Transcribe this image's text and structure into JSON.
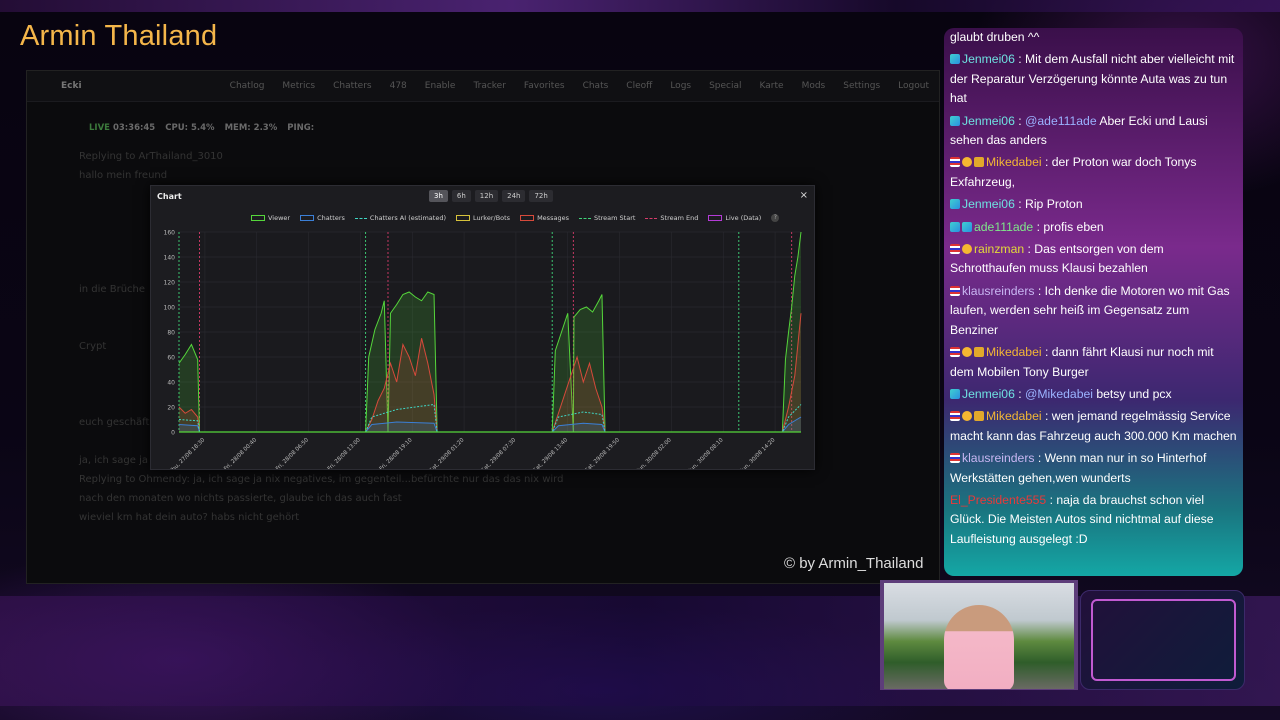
{
  "brand_title": "Armin Thailand",
  "watermark": "© by Armin_Thailand",
  "dashboard": {
    "app_name": "Ecki",
    "nav": [
      "Chatlog",
      "Metrics",
      "Chatters",
      "478",
      "Enable",
      "Tracker",
      "Favorites",
      "Chats",
      "Cleoff",
      "Logs",
      "Special",
      "Karte",
      "Mods",
      "Settings",
      "Logout"
    ],
    "status": {
      "live": "LIVE",
      "uptime": "03:36:45",
      "cpu_label": "CPU:",
      "cpu": "5.4%",
      "mem_label": "MEM:",
      "mem": "2.3%",
      "ping_label": "PING:"
    },
    "faint_chat": [
      "Replying to ArThailand_3010",
      "hallo mein freund",
      "",
      "",
      "",
      "",
      "",
      "in die Brüche",
      "",
      "",
      "Crypt",
      "",
      "",
      "",
      "euch geschäft",
      "",
      "ja, ich sage ja nix negatives, im gegenteil...befürchte nur das das nix wird",
      "Replying to Ohmendy: ja, ich sage ja nix negatives, im gegenteil...befürchte nur das das nix wird",
      "nach den monaten wo nichts passierte, glaube ich das auch fast",
      "wieviel km hat dein auto? habs nicht gehört"
    ]
  },
  "chart_panel": {
    "title": "Chart",
    "ranges": [
      "3h",
      "6h",
      "12h",
      "24h",
      "72h"
    ],
    "active_range": "3h",
    "close_label": "×",
    "help_label": "?"
  },
  "chart_data": {
    "type": "line",
    "ylim": [
      0,
      160
    ],
    "yticks": [
      0,
      20,
      40,
      60,
      80,
      100,
      120,
      140,
      160
    ],
    "xticks": [
      "Thu, 27/08 18:30",
      "Fri, 28/08 00:40",
      "Fri, 28/08 06:50",
      "Fri, 28/08 13:00",
      "Fri, 28/08 19:10",
      "Sat, 29/08 01:20",
      "Sat, 29/08 07:30",
      "Sat, 29/08 13:40",
      "Sat, 29/08 19:50",
      "Sun, 30/08 02:00",
      "Sun, 30/08 08:10",
      "Sun, 30/08 14:20"
    ],
    "xrange": [
      0,
      100
    ],
    "legend": [
      {
        "name": "Viewer",
        "color": "#55d63b",
        "style": "box"
      },
      {
        "name": "Chatters",
        "color": "#3b7fd6",
        "style": "box"
      },
      {
        "name": "Chatters AI (estimated)",
        "color": "#3fd6c4",
        "style": "dash"
      },
      {
        "name": "Lurker/Bots",
        "color": "#d6c23b",
        "style": "box"
      },
      {
        "name": "Messages",
        "color": "#d64a3b",
        "style": "box"
      },
      {
        "name": "Stream Start",
        "color": "#3fd67a",
        "style": "dash"
      },
      {
        "name": "Stream End",
        "color": "#d63b6a",
        "style": "dash"
      },
      {
        "name": "Live (Data)",
        "color": "#b43bd6",
        "style": "box"
      }
    ],
    "stream_starts": [
      0,
      30,
      60,
      90
    ],
    "stream_ends": [
      3.3,
      33.6,
      63.4,
      98.5
    ],
    "series": [
      {
        "name": "Viewer",
        "color": "#55d63b",
        "points": [
          [
            0,
            55
          ],
          [
            1,
            62
          ],
          [
            2,
            70
          ],
          [
            3,
            58
          ],
          [
            3.3,
            0
          ],
          [
            30,
            0
          ],
          [
            30.5,
            60
          ],
          [
            31.5,
            82
          ],
          [
            32.5,
            95
          ],
          [
            33,
            105
          ],
          [
            33.6,
            0
          ],
          [
            34,
            95
          ],
          [
            35,
            102
          ],
          [
            36,
            110
          ],
          [
            37,
            112
          ],
          [
            38,
            108
          ],
          [
            39,
            105
          ],
          [
            40,
            112
          ],
          [
            41,
            110
          ],
          [
            41.5,
            0
          ],
          [
            60,
            0
          ],
          [
            60.5,
            65
          ],
          [
            61.5,
            80
          ],
          [
            62.5,
            95
          ],
          [
            63.4,
            0
          ],
          [
            63.5,
            92
          ],
          [
            64.5,
            98
          ],
          [
            65.5,
            100
          ],
          [
            66.5,
            96
          ],
          [
            67.5,
            105
          ],
          [
            68,
            110
          ],
          [
            68.5,
            0
          ],
          [
            97,
            0
          ],
          [
            97.5,
            58
          ],
          [
            98,
            80
          ],
          [
            98.5,
            100
          ],
          [
            99,
            125
          ],
          [
            99.5,
            140
          ],
          [
            100,
            160
          ]
        ]
      },
      {
        "name": "Messages",
        "color": "#d64a3b",
        "points": [
          [
            0,
            20
          ],
          [
            1,
            15
          ],
          [
            2,
            18
          ],
          [
            3,
            12
          ],
          [
            3.3,
            0
          ],
          [
            30,
            0
          ],
          [
            31,
            10
          ],
          [
            32,
            25
          ],
          [
            33,
            35
          ],
          [
            34,
            55
          ],
          [
            35,
            40
          ],
          [
            36,
            70
          ],
          [
            37,
            60
          ],
          [
            38,
            45
          ],
          [
            39,
            75
          ],
          [
            40,
            55
          ],
          [
            41,
            30
          ],
          [
            41.5,
            0
          ],
          [
            60,
            0
          ],
          [
            61,
            15
          ],
          [
            62,
            30
          ],
          [
            63,
            45
          ],
          [
            64,
            60
          ],
          [
            65,
            40
          ],
          [
            66,
            55
          ],
          [
            67,
            35
          ],
          [
            68,
            20
          ],
          [
            68.5,
            0
          ],
          [
            97,
            0
          ],
          [
            98,
            20
          ],
          [
            99,
            45
          ],
          [
            100,
            95
          ]
        ]
      },
      {
        "name": "Chatters",
        "color": "#3b7fd6",
        "points": [
          [
            0,
            6
          ],
          [
            3,
            5
          ],
          [
            3.3,
            0
          ],
          [
            30,
            0
          ],
          [
            31,
            6
          ],
          [
            35,
            8
          ],
          [
            41,
            7
          ],
          [
            41.5,
            0
          ],
          [
            60,
            0
          ],
          [
            61,
            5
          ],
          [
            65,
            7
          ],
          [
            68,
            6
          ],
          [
            68.5,
            0
          ],
          [
            97,
            0
          ],
          [
            98,
            6
          ],
          [
            100,
            12
          ]
        ]
      },
      {
        "name": "Chatters AI (estimated)",
        "color": "#3fd6c4",
        "dashed": true,
        "points": [
          [
            0,
            10
          ],
          [
            3,
            9
          ],
          [
            3.3,
            0
          ],
          [
            30,
            0
          ],
          [
            31,
            12
          ],
          [
            35,
            18
          ],
          [
            41,
            22
          ],
          [
            41.5,
            0
          ],
          [
            60,
            0
          ],
          [
            61,
            12
          ],
          [
            65,
            16
          ],
          [
            68,
            14
          ],
          [
            68.5,
            0
          ],
          [
            97,
            0
          ],
          [
            98,
            12
          ],
          [
            100,
            22
          ]
        ]
      }
    ]
  },
  "chat": [
    {
      "badges": [],
      "user": "",
      "user_color": "#ffffff",
      "text": "glaubt druben ^^"
    },
    {
      "badges": [
        "sub"
      ],
      "user": "Jenmei06",
      "user_color": "#6fe0e0",
      "text": ": Mit dem Ausfall nicht aber vielleicht mit der Reparatur Verzögerung könnte Auta was zu tun hat"
    },
    {
      "badges": [
        "sub"
      ],
      "user": "Jenmei06",
      "user_color": "#6fe0e0",
      "text": ": @ade111ade Aber Ecki und Lausi sehen das anders",
      "mention": "@ade111ade"
    },
    {
      "badges": [
        "flag",
        "coin",
        "crown"
      ],
      "user": "Mikedabei",
      "user_color": "#f2b636",
      "text": ": der Proton war doch Tonys Exfahrzeug,"
    },
    {
      "badges": [
        "sub"
      ],
      "user": "Jenmei06",
      "user_color": "#6fe0e0",
      "text": ": Rip Proton"
    },
    {
      "badges": [
        "sub",
        "sub"
      ],
      "user": "ade111ade",
      "user_color": "#7fe88a",
      "text": ": profis eben"
    },
    {
      "badges": [
        "flag",
        "coin"
      ],
      "user": "rainzman",
      "user_color": "#e3d93a",
      "text": ": Das entsorgen von dem Schrotthaufen muss Klausi bezahlen"
    },
    {
      "badges": [
        "flag"
      ],
      "user": "klausreinders",
      "user_color": "#c8b6f2",
      "text": ": Ich denke die Motoren wo mit Gas laufen, werden sehr heiß im Gegensatz zum Benziner"
    },
    {
      "badges": [
        "flag",
        "coin",
        "crown"
      ],
      "user": "Mikedabei",
      "user_color": "#f2b636",
      "text": ": dann fährt Klausi nur noch mit dem Mobilen Tony Burger"
    },
    {
      "badges": [
        "sub"
      ],
      "user": "Jenmei06",
      "user_color": "#6fe0e0",
      "text": ": @Mikedabei betsy und pcx",
      "mention": "@Mikedabei"
    },
    {
      "badges": [
        "flag",
        "coin",
        "crown"
      ],
      "user": "Mikedabei",
      "user_color": "#f2b636",
      "text": ": wen jemand regelmässig Service macht kann das Fahrzeug auch 300.000 Km machen"
    },
    {
      "badges": [
        "flag"
      ],
      "user": "klausreinders",
      "user_color": "#c8b6f2",
      "text": ": Wenn man nur in so Hinterhof Werkstätten gehen,wen wunderts"
    },
    {
      "badges": [],
      "user": "El_Presidente555",
      "user_color": "#e83a3a",
      "text": ": naja da brauchst schon viel Glück. Die Meisten Autos sind nichtmal auf diese Laufleistung ausgelegt :D"
    }
  ]
}
